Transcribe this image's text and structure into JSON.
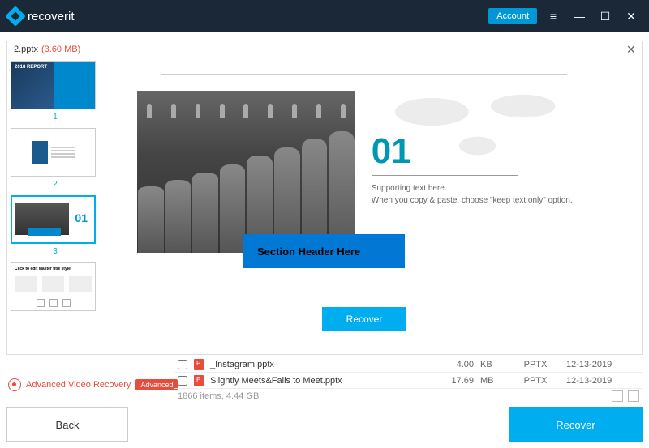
{
  "app": {
    "name": "recoverit",
    "account_label": "Account"
  },
  "preview": {
    "filename": "2.pptx",
    "filesize": "(3.60 MB)",
    "selected_thumb_index": 3,
    "thumb1_label": "2018 REPORT",
    "thumb4_title": "Click to edit Master title style",
    "slide": {
      "number": "01",
      "header": "Section Header Here",
      "support1": "Supporting text here.",
      "support2": "When you copy & paste, choose \"keep text only\" option."
    },
    "recover_label": "Recover"
  },
  "files": [
    {
      "name": "_Instagram.pptx",
      "size": "4.00",
      "unit": "KB",
      "type": "PPTX",
      "date": "12-13-2019"
    },
    {
      "name": "Slightly Meets&Fails to Meet.pptx",
      "size": "17.69",
      "unit": "MB",
      "type": "PPTX",
      "date": "12-13-2019"
    }
  ],
  "totals": "1866 items, 4.44  GB",
  "advanced": {
    "label": "Advanced Video Recovery",
    "badge": "Advanced"
  },
  "footer": {
    "back": "Back",
    "recover": "Recover"
  }
}
